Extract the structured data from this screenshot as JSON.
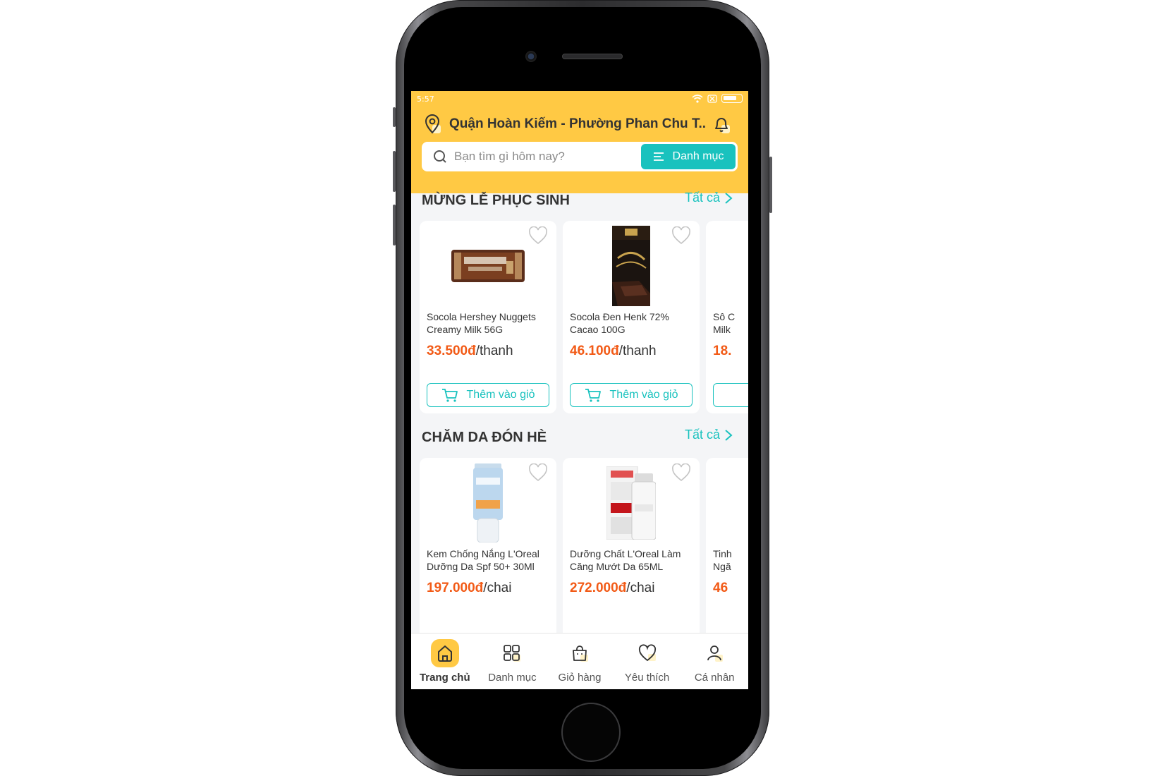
{
  "status_bar": {
    "time": "5:57"
  },
  "header": {
    "location": "Quận Hoàn Kiếm - Phường Phan Chu T..",
    "search_placeholder": "Bạn tìm gì hôm nay?",
    "category_button": "Danh mục"
  },
  "sections": [
    {
      "title": "MỪNG LỄ PHỤC SINH",
      "see_all": "Tất cả",
      "products": [
        {
          "name": "Socola Hershey Nuggets Creamy Milk 56G",
          "price": "33.500đ",
          "unit": "/thanh",
          "add_label": "Thêm vào giỏ",
          "image": "hershey-nuggets-bar"
        },
        {
          "name": "Socola Đen Henk 72% Cacao 100G",
          "price": "46.100đ",
          "unit": "/thanh",
          "add_label": "Thêm vào giỏ",
          "image": "henk-dark-chocolate"
        },
        {
          "name": "Sô C Milk",
          "price": "18.",
          "unit": "",
          "add_label": "",
          "image": ""
        }
      ]
    },
    {
      "title": "CHĂM DA ĐÓN HÈ",
      "see_all": "Tất cả",
      "products": [
        {
          "name": "Kem Chống Nắng L'Oreal Dưỡng Da Spf 50+ 30Ml",
          "price": "197.000đ",
          "unit": "/chai",
          "image": "loreal-uv-perfect-bottle"
        },
        {
          "name": "Dưỡng Chất L'Oreal Làm Căng Mướt Da 65ML",
          "price": "272.000đ",
          "unit": "/chai",
          "image": "loreal-revitalift-set"
        },
        {
          "name": "Tinh Ngă",
          "price": "46",
          "unit": "",
          "image": ""
        }
      ]
    }
  ],
  "bottom_nav": [
    {
      "label": "Trang chủ",
      "icon": "home-icon",
      "active": true
    },
    {
      "label": "Danh mục",
      "icon": "grid-icon",
      "active": false
    },
    {
      "label": "Giỏ hàng",
      "icon": "bag-icon",
      "active": false
    },
    {
      "label": "Yêu thích",
      "icon": "heart-icon",
      "active": false
    },
    {
      "label": "Cá nhân",
      "icon": "user-icon",
      "active": false
    }
  ],
  "colors": {
    "brand_yellow": "#ffc944",
    "accent_teal": "#19c2be",
    "price_orange": "#f25a16"
  }
}
